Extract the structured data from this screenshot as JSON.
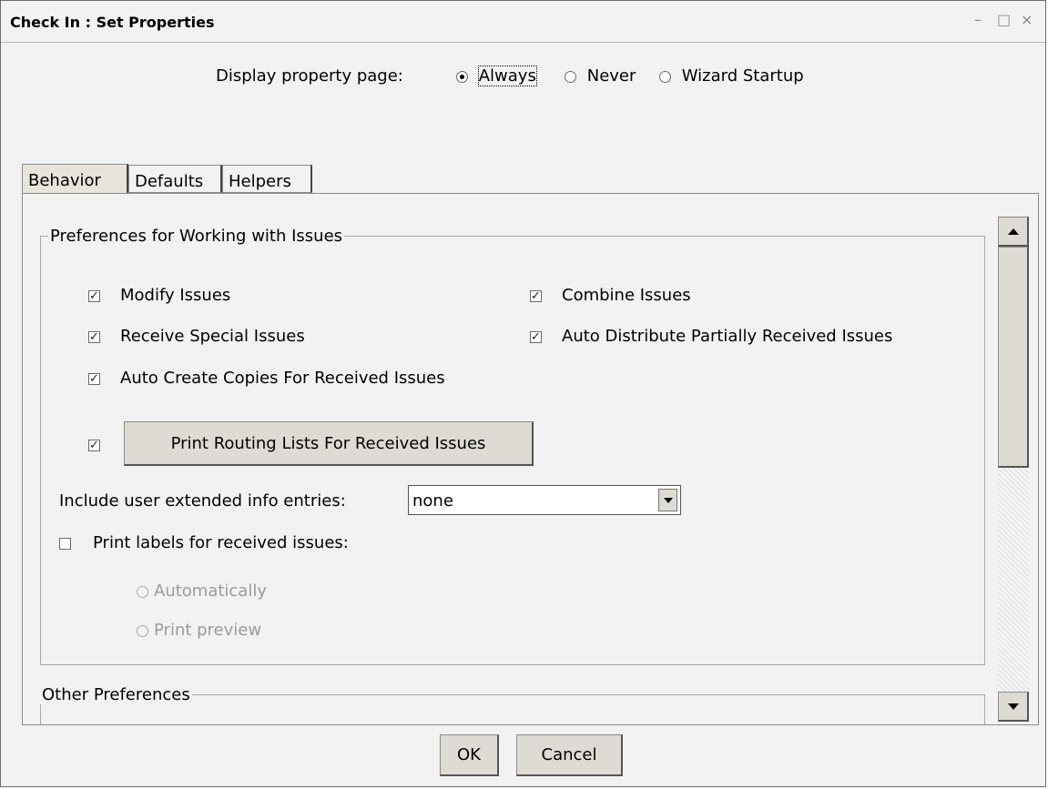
{
  "window": {
    "title": "Check In : Set Properties",
    "minimize": "–",
    "maximize": "□",
    "close": "×"
  },
  "display_page": {
    "label": "Display property page:",
    "options": [
      "Always",
      "Never",
      "Wizard Startup"
    ],
    "selected": "Always"
  },
  "tabs": [
    "Behavior",
    "Defaults",
    "Helpers"
  ],
  "active_tab": "Behavior",
  "group1": {
    "legend": "Preferences for Working with Issues",
    "modify_issues": "Modify Issues",
    "combine_issues": "Combine Issues",
    "receive_special": "Receive Special Issues",
    "auto_distribute": "Auto Distribute Partially Received Issues",
    "auto_create_copies": "Auto Create Copies For Received Issues",
    "print_routing_button": "Print Routing Lists For Received Issues",
    "extended_info_label": "Include user extended info entries:",
    "extended_info_value": "none",
    "print_labels": "Print labels for received issues:",
    "auto_radio": "Automatically",
    "preview_radio": "Print preview"
  },
  "group2": {
    "legend": "Other Preferences"
  },
  "checkmark": "✓",
  "footer": {
    "ok": "OK",
    "cancel": "Cancel"
  }
}
